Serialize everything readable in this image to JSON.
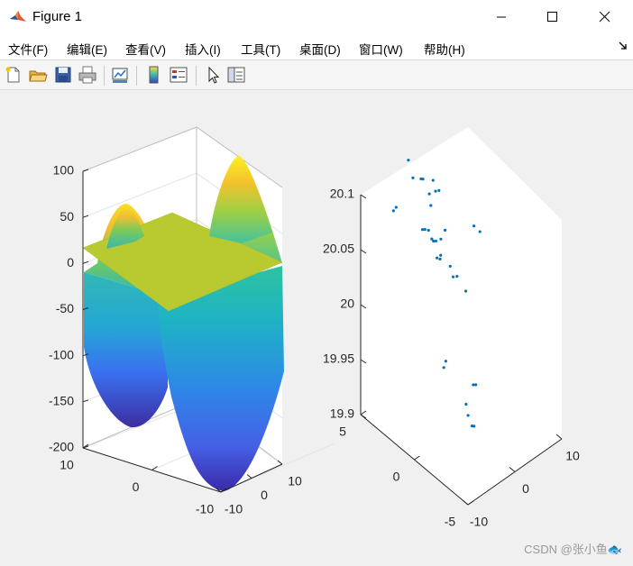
{
  "window": {
    "title": "Figure 1",
    "controls": [
      "minimize",
      "maximize",
      "close"
    ]
  },
  "menu": [
    "文件(F)",
    "编辑(E)",
    "查看(V)",
    "插入(I)",
    "工具(T)",
    "桌面(D)",
    "窗口(W)",
    "帮助(H)"
  ],
  "toolbar": {
    "icons": [
      "new-figure-icon",
      "open-file-icon",
      "save-icon",
      "print-icon",
      "link-plot-icon",
      "colorbar-icon",
      "legend-icon",
      "edit-plot-arrow-icon",
      "property-editor-icon"
    ]
  },
  "chart_data": [
    {
      "type": "surface",
      "colormap": "parula",
      "x_ticks": [
        "-10",
        "0",
        "10"
      ],
      "y_ticks": [
        "-10",
        "0",
        "10"
      ],
      "z_ticks": [
        "-200",
        "-150",
        "-100",
        "-50",
        "0",
        "50",
        "100"
      ],
      "xlim": [
        -10,
        10
      ],
      "ylim": [
        -10,
        10
      ],
      "zlim": [
        -200,
        100
      ],
      "surfaces": [
        {
          "name": "",
          "description": "saddle-like curved surface with two peaks near z≈100 and two troughs near z≈-200"
        },
        {
          "name": "",
          "description": "flat plane at constant z",
          "z": 20
        }
      ],
      "grid": true
    },
    {
      "type": "scatter3",
      "marker_color": "#0072bd",
      "x_ticks": [
        "-10",
        "0",
        "10"
      ],
      "y_ticks": [
        "-5",
        "0",
        "5"
      ],
      "z_ticks": [
        "19.9",
        "19.95",
        "20",
        "20.05",
        "20.1"
      ],
      "xlim": [
        -10,
        10
      ],
      "ylim": [
        -5,
        5
      ],
      "zlim": [
        19.9,
        20.1
      ],
      "grid": false,
      "points": [
        [
          -6.9,
          3.3,
          20.09
        ],
        [
          -6.1,
          3.4,
          20.09
        ],
        [
          -4.6,
          1.6,
          20.08
        ],
        [
          -4.3,
          1.5,
          20.08
        ],
        [
          -4.0,
          1.3,
          20.08
        ],
        [
          -3.3,
          1.3,
          20.07
        ],
        [
          -3.4,
          1.1,
          20.07
        ],
        [
          -3.1,
          1.0,
          20.07
        ],
        [
          -3.8,
          0.6,
          20.06
        ],
        [
          -3.6,
          0.4,
          20.06
        ],
        [
          -3.0,
          0.6,
          20.06
        ],
        [
          -1.2,
          4.4,
          20.11
        ],
        [
          -1.6,
          3.8,
          20.1
        ],
        [
          -0.8,
          3.4,
          20.1
        ],
        [
          -0.6,
          3.3,
          20.1
        ],
        [
          -0.4,
          2.8,
          20.09
        ],
        [
          -0.3,
          2.7,
          20.08
        ],
        [
          0.4,
          2.8,
          20.1
        ],
        [
          0.7,
          2.7,
          20.09
        ],
        [
          1.2,
          2.6,
          20.09
        ],
        [
          -1.9,
          0.2,
          20.05
        ],
        [
          -1.5,
          0.1,
          20.04
        ],
        [
          -2.5,
          -0.7,
          20.05
        ],
        [
          -2.0,
          -1.3,
          20.04
        ],
        [
          -6.0,
          -1.0,
          19.98
        ],
        [
          -4.9,
          -0.7,
          19.98
        ],
        [
          2.5,
          2.6,
          20.05
        ],
        [
          2.3,
          2.9,
          20.04
        ],
        [
          -2.4,
          -1.5,
          19.94
        ],
        [
          -2.2,
          -1.6,
          19.93
        ],
        [
          -0.4,
          -1.3,
          19.95
        ],
        [
          -0.1,
          -1.4,
          19.95
        ],
        [
          -3.2,
          -2.4,
          19.93
        ],
        [
          -3.0,
          -2.5,
          19.93
        ],
        [
          3.4,
          0.3,
          20.07
        ],
        [
          3.3,
          -0.3,
          20.07
        ]
      ]
    }
  ],
  "watermark": "CSDN @张小鱼🐟"
}
